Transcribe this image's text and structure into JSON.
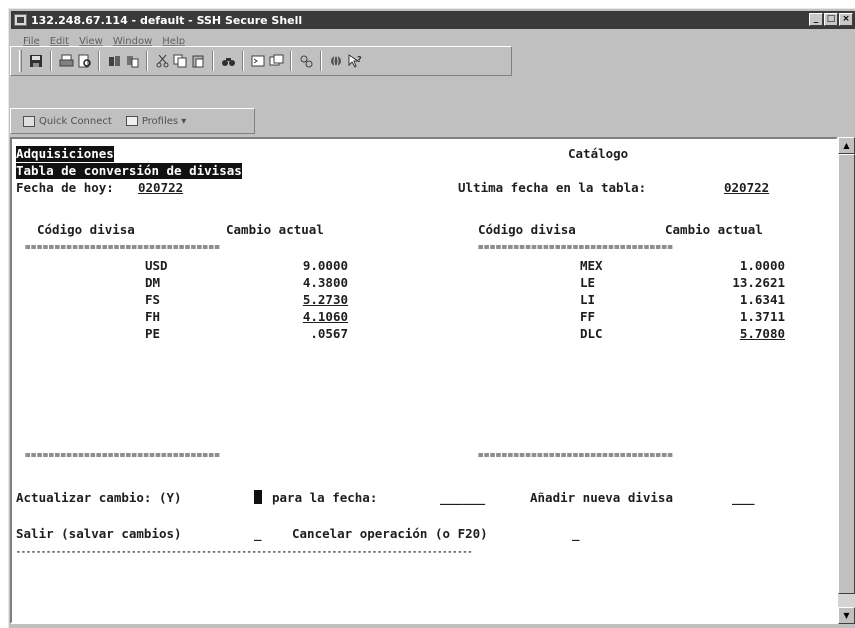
{
  "window": {
    "title": "132.248.67.114 - default - SSH Secure Shell",
    "buttons": [
      "_",
      "□",
      "×"
    ]
  },
  "menu": [
    "File",
    "Edit",
    "View",
    "Window",
    "Help"
  ],
  "toolbar_icons": [
    "save-icon",
    "print-icon",
    "print-preview-icon",
    "copy-icon",
    "paste-icon",
    "cut-icon",
    "copy2-icon",
    "paste2-icon",
    "find-icon",
    "new-terminal-icon",
    "file-transfer-icon",
    "settings-icon",
    "globe-icon",
    "help-icon"
  ],
  "quickbar": {
    "quick_connect": "Quick Connect",
    "profiles": "Profiles ▾"
  },
  "screen": {
    "header_left": "Adquisiciones",
    "header_center": "Catálogo",
    "subtitle": "Tabla de conversión de divisas",
    "fecha_label": "Fecha de hoy:",
    "fecha_value": "020722",
    "ultima_label": "Ultima fecha en la tabla:",
    "ultima_value": "020722",
    "col_codigo": "Código divisa",
    "col_cambio": "Cambio actual",
    "separator": "=================================",
    "left_rows": [
      {
        "code": "USD",
        "rate": "9.0000"
      },
      {
        "code": "DM",
        "rate": "4.3800"
      },
      {
        "code": "FS",
        "rate": "5.2730"
      },
      {
        "code": "FH",
        "rate": "4.1060"
      },
      {
        "code": "PE",
        "rate": ".0567"
      }
    ],
    "right_rows": [
      {
        "code": "MEX",
        "rate": "1.0000"
      },
      {
        "code": "LE",
        "rate": "13.2621"
      },
      {
        "code": "LI",
        "rate": "1.6341"
      },
      {
        "code": "FF",
        "rate": "1.3711"
      },
      {
        "code": "DLC",
        "rate": "5.7080"
      }
    ],
    "actualizar_label": "Actualizar cambio: (Y)",
    "para_fecha_label": "para la fecha:",
    "para_fecha_field": "______",
    "anadir_label": "Añadir nueva divisa",
    "anadir_field": "___",
    "salir_label": "Salir (salvar cambios)",
    "salir_field": "_",
    "cancelar_label": "Cancelar operación (o F20)",
    "cancelar_field": "_",
    "bottom_separator": "-------------------------------------------------------------------------------------------"
  }
}
